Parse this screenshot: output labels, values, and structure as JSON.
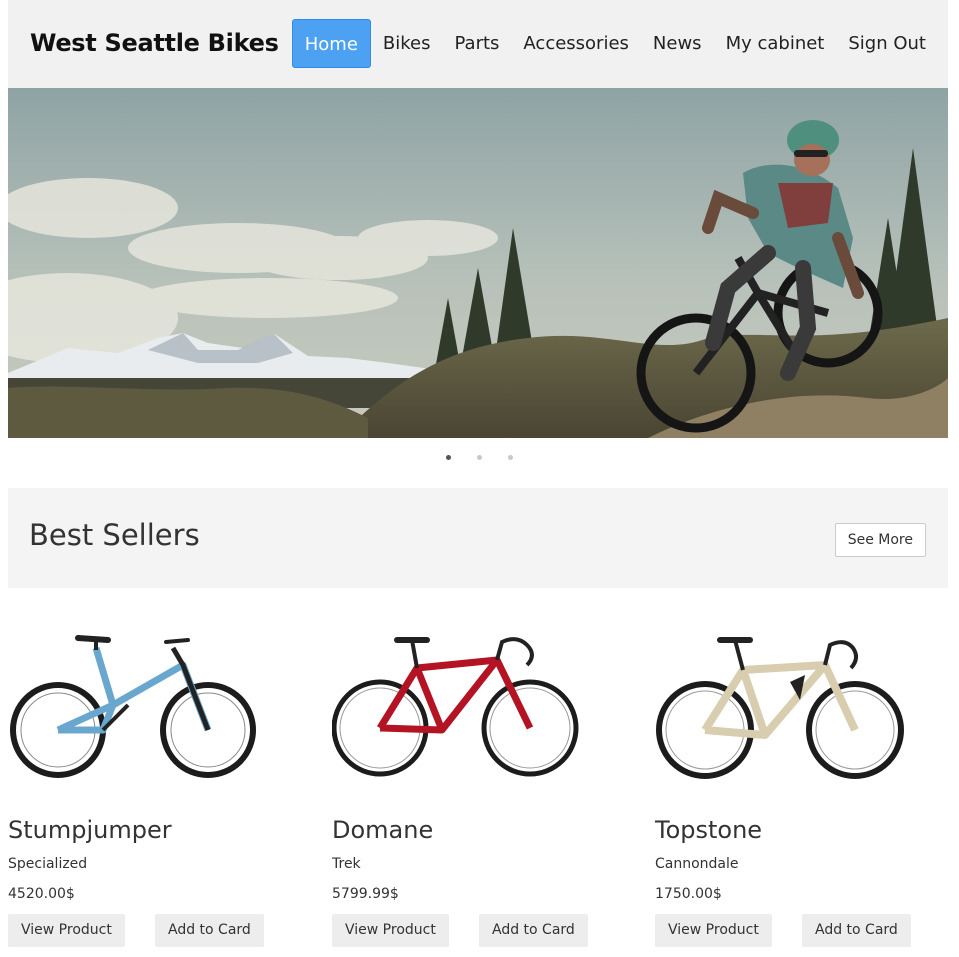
{
  "brand": "West Seattle Bikes",
  "nav": {
    "home": "Home",
    "bikes": "Bikes",
    "parts": "Parts",
    "accessories": "Accessories",
    "news": "News",
    "cabinet": "My cabinet",
    "signout": "Sign Out"
  },
  "carousel": {
    "active_slide": 1,
    "slide_count": 3
  },
  "best_sellers": {
    "title": "Best Sellers",
    "see_more": "See More"
  },
  "products": [
    {
      "name": "Stumpjumper",
      "brand": "Specialized",
      "price": "4520.00$",
      "view": "View Product",
      "add": "Add to Card",
      "frame_color": "#6aa7cf"
    },
    {
      "name": "Domane",
      "brand": "Trek",
      "price": "5799.99$",
      "view": "View Product",
      "add": "Add to Card",
      "frame_color": "#b31322"
    },
    {
      "name": "Topstone",
      "brand": "Cannondale",
      "price": "1750.00$",
      "view": "View Product",
      "add": "Add to Card",
      "frame_color": "#d9cdb0"
    }
  ],
  "colors": {
    "accent": "#4da1f3",
    "header_bg": "#f1f1f1",
    "section_bg": "#f4f4f4"
  }
}
